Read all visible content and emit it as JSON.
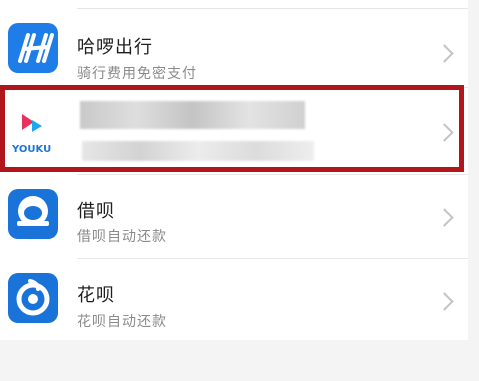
{
  "apps": [
    {
      "name": "哈啰出行",
      "desc": "骑行费用免密支付",
      "icon": "hellobike-icon",
      "color": "#1f7de8"
    },
    {
      "name": "",
      "desc": "",
      "icon": "youku-icon",
      "logo_text": "YOUKU",
      "color": "#1e75d6",
      "redacted": true
    },
    {
      "name": "借呗",
      "desc": "借呗自动还款",
      "icon": "jiebei-icon",
      "color": "#1a73d9"
    },
    {
      "name": "花呗",
      "desc": "花呗自动还款",
      "icon": "huabei-icon",
      "color": "#1a73d9"
    }
  ],
  "colors": {
    "highlight": "#b0161b",
    "chevron": "#c4c4c4"
  }
}
